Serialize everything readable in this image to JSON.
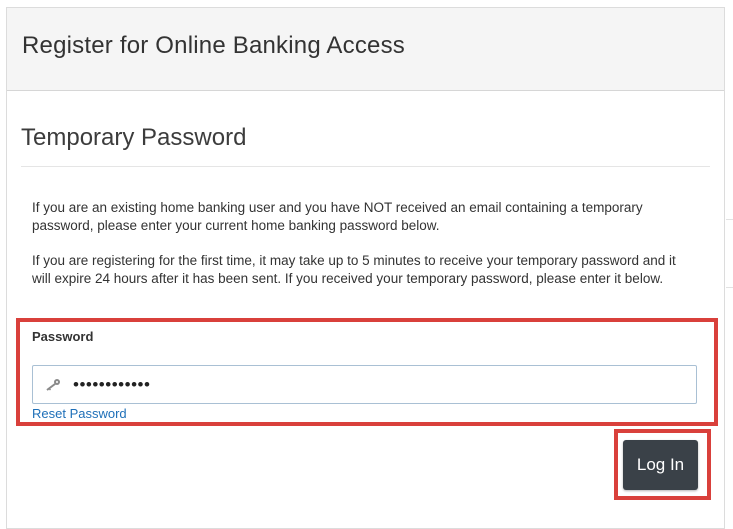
{
  "header": {
    "title": "Register for Online Banking Access"
  },
  "section": {
    "title": "Temporary Password"
  },
  "instructions": {
    "paragraph_1": "If you are an existing home banking user and you have NOT received an email containing a temporary password, please enter your current home banking password below.",
    "paragraph_2": "If you are registering for the first time, it may take up to 5 minutes to receive your temporary password and it will expire 24 hours after it has been sent. If you received your temporary password, please enter it below."
  },
  "password_field": {
    "label": "Password",
    "value": "••••••••••••",
    "icon": "key-icon"
  },
  "reset_link": {
    "label": "Reset Password"
  },
  "login_button": {
    "label": "Log In"
  },
  "colors": {
    "highlight": "#d9403b",
    "button_bg": "#3a4148",
    "link": "#1e6fb8",
    "header_bg": "#f5f5f5"
  }
}
